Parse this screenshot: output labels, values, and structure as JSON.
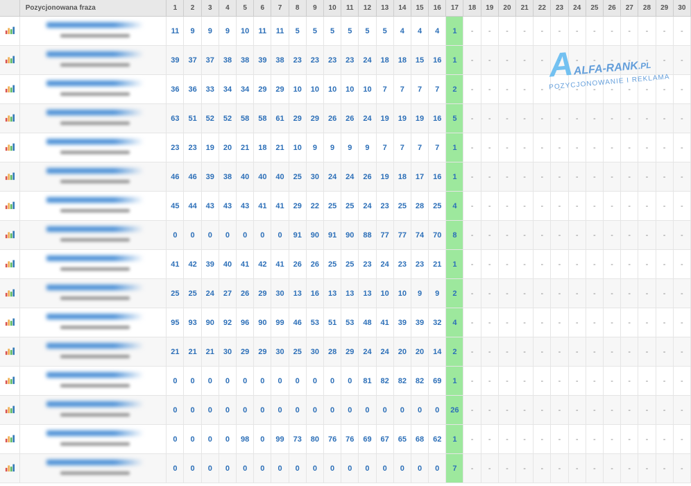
{
  "header": {
    "phrase_label": "Pozycjonowana fraza",
    "days": [
      "1",
      "2",
      "3",
      "4",
      "5",
      "6",
      "7",
      "8",
      "9",
      "10",
      "11",
      "12",
      "13",
      "14",
      "15",
      "16",
      "17",
      "18",
      "19",
      "20",
      "21",
      "22",
      "23",
      "24",
      "25",
      "26",
      "27",
      "28",
      "29",
      "30"
    ]
  },
  "highlight_col": 16,
  "watermark": {
    "brand": "ALFA-RANK",
    "tld": ".PL",
    "tagline": "POZYCJONOWANIE I REKLAMA"
  },
  "rows": [
    {
      "vals": [
        "11",
        "9",
        "9",
        "9",
        "10",
        "11",
        "11",
        "5",
        "5",
        "5",
        "5",
        "5",
        "5",
        "4",
        "4",
        "4",
        "1",
        "-",
        "-",
        "-",
        "-",
        "-",
        "-",
        "-",
        "-",
        "-",
        "-",
        "-",
        "-",
        "-"
      ]
    },
    {
      "vals": [
        "39",
        "37",
        "37",
        "38",
        "38",
        "39",
        "38",
        "23",
        "23",
        "23",
        "23",
        "24",
        "18",
        "18",
        "15",
        "16",
        "1",
        "-",
        "-",
        "-",
        "-",
        "-",
        "-",
        "-",
        "-",
        "-",
        "-",
        "-",
        "-",
        "-"
      ]
    },
    {
      "vals": [
        "36",
        "36",
        "33",
        "34",
        "34",
        "29",
        "29",
        "10",
        "10",
        "10",
        "10",
        "10",
        "7",
        "7",
        "7",
        "7",
        "2",
        "-",
        "-",
        "-",
        "-",
        "-",
        "-",
        "-",
        "-",
        "-",
        "-",
        "-",
        "-",
        "-"
      ]
    },
    {
      "vals": [
        "63",
        "51",
        "52",
        "52",
        "58",
        "58",
        "61",
        "29",
        "29",
        "26",
        "26",
        "24",
        "19",
        "19",
        "19",
        "16",
        "5",
        "-",
        "-",
        "-",
        "-",
        "-",
        "-",
        "-",
        "-",
        "-",
        "-",
        "-",
        "-",
        "-"
      ]
    },
    {
      "vals": [
        "23",
        "23",
        "19",
        "20",
        "21",
        "18",
        "21",
        "10",
        "9",
        "9",
        "9",
        "9",
        "7",
        "7",
        "7",
        "7",
        "1",
        "-",
        "-",
        "-",
        "-",
        "-",
        "-",
        "-",
        "-",
        "-",
        "-",
        "-",
        "-",
        "-"
      ]
    },
    {
      "vals": [
        "46",
        "46",
        "39",
        "38",
        "40",
        "40",
        "40",
        "25",
        "30",
        "24",
        "24",
        "26",
        "19",
        "18",
        "17",
        "16",
        "1",
        "-",
        "-",
        "-",
        "-",
        "-",
        "-",
        "-",
        "-",
        "-",
        "-",
        "-",
        "-",
        "-"
      ]
    },
    {
      "vals": [
        "45",
        "44",
        "43",
        "43",
        "43",
        "41",
        "41",
        "29",
        "22",
        "25",
        "25",
        "24",
        "23",
        "25",
        "28",
        "25",
        "4",
        "-",
        "-",
        "-",
        "-",
        "-",
        "-",
        "-",
        "-",
        "-",
        "-",
        "-",
        "-",
        "-"
      ]
    },
    {
      "vals": [
        "0",
        "0",
        "0",
        "0",
        "0",
        "0",
        "0",
        "91",
        "90",
        "91",
        "90",
        "88",
        "77",
        "77",
        "74",
        "70",
        "8",
        "-",
        "-",
        "-",
        "-",
        "-",
        "-",
        "-",
        "-",
        "-",
        "-",
        "-",
        "-",
        "-"
      ]
    },
    {
      "vals": [
        "41",
        "42",
        "39",
        "40",
        "41",
        "42",
        "41",
        "26",
        "26",
        "25",
        "25",
        "23",
        "24",
        "23",
        "23",
        "21",
        "1",
        "-",
        "-",
        "-",
        "-",
        "-",
        "-",
        "-",
        "-",
        "-",
        "-",
        "-",
        "-",
        "-"
      ]
    },
    {
      "vals": [
        "25",
        "25",
        "24",
        "27",
        "26",
        "29",
        "30",
        "13",
        "16",
        "13",
        "13",
        "13",
        "10",
        "10",
        "9",
        "9",
        "2",
        "-",
        "-",
        "-",
        "-",
        "-",
        "-",
        "-",
        "-",
        "-",
        "-",
        "-",
        "-",
        "-"
      ]
    },
    {
      "vals": [
        "95",
        "93",
        "90",
        "92",
        "96",
        "90",
        "99",
        "46",
        "53",
        "51",
        "53",
        "48",
        "41",
        "39",
        "39",
        "32",
        "4",
        "-",
        "-",
        "-",
        "-",
        "-",
        "-",
        "-",
        "-",
        "-",
        "-",
        "-",
        "-",
        "-"
      ]
    },
    {
      "vals": [
        "21",
        "21",
        "21",
        "30",
        "29",
        "29",
        "30",
        "25",
        "30",
        "28",
        "29",
        "24",
        "24",
        "20",
        "20",
        "14",
        "2",
        "-",
        "-",
        "-",
        "-",
        "-",
        "-",
        "-",
        "-",
        "-",
        "-",
        "-",
        "-",
        "-"
      ]
    },
    {
      "vals": [
        "0",
        "0",
        "0",
        "0",
        "0",
        "0",
        "0",
        "0",
        "0",
        "0",
        "0",
        "81",
        "82",
        "82",
        "82",
        "69",
        "1",
        "-",
        "-",
        "-",
        "-",
        "-",
        "-",
        "-",
        "-",
        "-",
        "-",
        "-",
        "-",
        "-"
      ]
    },
    {
      "vals": [
        "0",
        "0",
        "0",
        "0",
        "0",
        "0",
        "0",
        "0",
        "0",
        "0",
        "0",
        "0",
        "0",
        "0",
        "0",
        "0",
        "26",
        "-",
        "-",
        "-",
        "-",
        "-",
        "-",
        "-",
        "-",
        "-",
        "-",
        "-",
        "-",
        "-"
      ]
    },
    {
      "vals": [
        "0",
        "0",
        "0",
        "0",
        "98",
        "0",
        "99",
        "73",
        "80",
        "76",
        "76",
        "69",
        "67",
        "65",
        "68",
        "62",
        "1",
        "-",
        "-",
        "-",
        "-",
        "-",
        "-",
        "-",
        "-",
        "-",
        "-",
        "-",
        "-",
        "-"
      ]
    },
    {
      "vals": [
        "0",
        "0",
        "0",
        "0",
        "0",
        "0",
        "0",
        "0",
        "0",
        "0",
        "0",
        "0",
        "0",
        "0",
        "0",
        "0",
        "7",
        "-",
        "-",
        "-",
        "-",
        "-",
        "-",
        "-",
        "-",
        "-",
        "-",
        "-",
        "-",
        "-"
      ]
    }
  ]
}
